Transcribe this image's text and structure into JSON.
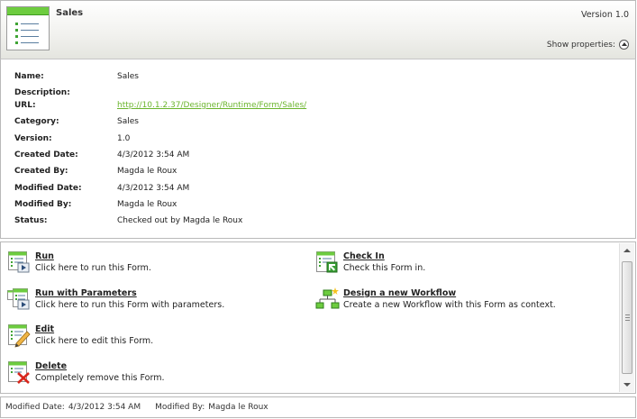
{
  "header": {
    "title": "Sales",
    "version": "Version 1.0",
    "show_properties": "Show properties:"
  },
  "properties": [
    {
      "label": "Name:",
      "value": "Sales"
    },
    {
      "label": "Description:",
      "value": ""
    },
    {
      "label": "URL:",
      "value": "http://10.1.2.37/Designer/Runtime/Form/Sales/",
      "link": true
    },
    {
      "label": "Category:",
      "value": "Sales"
    },
    {
      "label": "Version:",
      "value": "1.0"
    },
    {
      "label": "Created Date:",
      "value": "4/3/2012 3:54 AM"
    },
    {
      "label": "Created By:",
      "value": "Magda le Roux"
    },
    {
      "label": "Modified Date:",
      "value": "4/3/2012 3:54 AM"
    },
    {
      "label": "Modified By:",
      "value": "Magda le Roux"
    },
    {
      "label": "Status:",
      "value": "Checked out by Magda le Roux"
    }
  ],
  "actions": {
    "run": {
      "title": "Run",
      "desc": "Click here to run this Form.",
      "icon": "form-run-icon"
    },
    "run_params": {
      "title": "Run with Parameters",
      "desc": "Click here to run this Form with parameters.",
      "icon": "form-run-parameters-icon"
    },
    "edit": {
      "title": "Edit",
      "desc": "Click here to edit this Form.",
      "icon": "form-edit-icon"
    },
    "delete": {
      "title": "Delete",
      "desc": "Completely remove this Form.",
      "icon": "form-delete-icon"
    },
    "check_in": {
      "title": "Check In",
      "desc": "Check this Form in.",
      "icon": "form-check-in-icon"
    },
    "workflow": {
      "title": "Design a new Workflow",
      "desc": "Create a new Workflow with this Form as context.",
      "icon": "workflow-design-icon"
    }
  },
  "footer": {
    "modified_date_label": "Modified Date:",
    "modified_date": "4/3/2012 3:54 AM",
    "modified_by_label": "Modified By:",
    "modified_by": "Magda le Roux"
  },
  "colors": {
    "accent_green": "#6dcc3f",
    "link_green": "#6bb52d"
  }
}
